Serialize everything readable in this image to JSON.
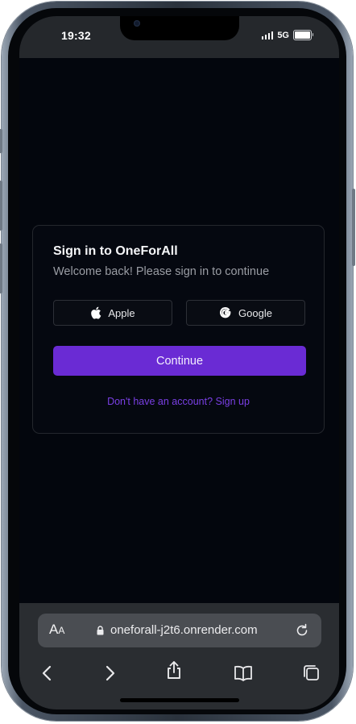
{
  "status": {
    "time": "19:32",
    "network": "5G"
  },
  "auth": {
    "title": "Sign in to OneForAll",
    "subtitle": "Welcome back! Please sign in to continue",
    "apple_label": "Apple",
    "google_label": "Google",
    "continue_label": "Continue",
    "signup_text": "Don't have an account? Sign up"
  },
  "browser": {
    "text_size_label": "AA",
    "url": "oneforall-j2t6.onrender.com",
    "icons": [
      "lock-icon",
      "reload-icon",
      "back-icon",
      "forward-icon",
      "share-icon",
      "bookmarks-icon",
      "tabs-icon"
    ]
  },
  "colors": {
    "accent": "#6a2bd4",
    "link": "#7a3fe4",
    "background": "#03060d",
    "card_border": "#24272d"
  }
}
